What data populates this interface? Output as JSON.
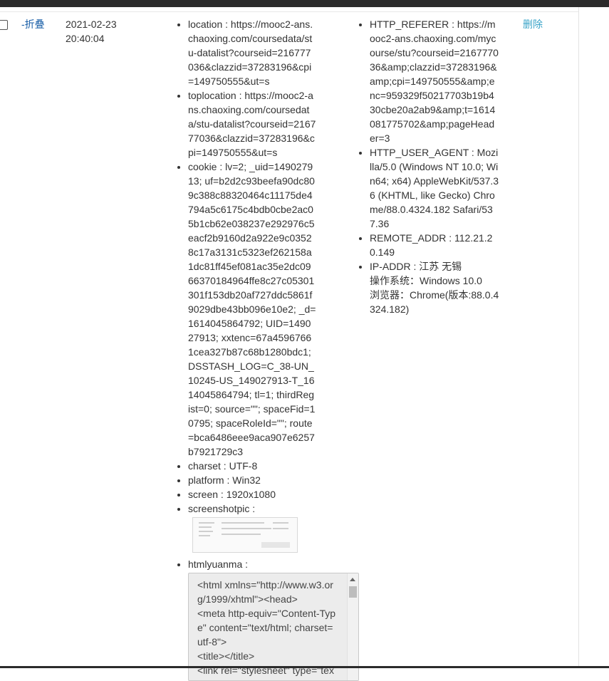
{
  "row": {
    "toggle_label": "-折叠",
    "date_line1": "2021-02-23",
    "date_line2": "20:40:04",
    "delete_label": "删除",
    "left_details": [
      "location : https://mooc2-ans.chaoxing.com/coursedata/stu-datalist?courseid=216777036&clazzid=37283196&cpi=149750555&ut=s",
      "toplocation : https://mooc2-ans.chaoxing.com/coursedata/stu-datalist?courseid=216777036&clazzid=37283196&cpi=149750555&ut=s",
      "cookie : lv=2; _uid=149027913; uf=b2d2c93beefa90dc809c388c88320464c11175de4794a5c6175c4bdb0cbe2ac05b1cb62e038237e292976c5eacf2b9160d2a922e9c03528c17a3131c5323ef262158a1dc81ff45ef081ac35e2dc0966370184964ffe8c27c05301301f153db20af727ddc5861f9029dbe43bb096e10e2; _d=1614045864792; UID=149027913; xxtenc=67a45967661cea327b87c68b1280bdc1; DSSTASH_LOG=C_38-UN_10245-US_149027913-T_1614045864794; tl=1; thirdRegist=0; source=\"\"; spaceFid=10795; spaceRoleId=\"\"; route=bca6486eee9aca907e6257b7921729c3",
      "charset : UTF-8",
      "platform : Win32",
      "screen : 1920x1080"
    ],
    "screenshot_label": "screenshotpic :",
    "html_label": "htmlyuanma :",
    "html_source": "<html xmlns=\"http://www.w3.org/1999/xhtml\"><head>\n<meta http-equiv=\"Content-Type\" content=\"text/html; charset=utf-8\">\n<title></title>\n<link rel=\"stylesheet\" type=\"text/css\" href=\"",
    "right_details": [
      "HTTP_REFERER : https://mooc2-ans.chaoxing.com/mycourse/stu?courseid=216777036&amp;clazzid=37283196&amp;cpi=149750555&amp;enc=959329f50217703b19b430cbe20a2ab9&amp;t=1614081775702&amp;pageHeader=3",
      "HTTP_USER_AGENT : Mozilla/5.0 (Windows NT 10.0; Win64; x64) AppleWebKit/537.36 (KHTML, like Gecko) Chrome/88.0.4324.182 Safari/537.36",
      "REMOTE_ADDR : 112.21.20.149"
    ],
    "ip_addr": "IP-ADDR : 江苏 无锡",
    "os": "操作系统：Windows 10.0",
    "browser": "浏览器：Chrome(版本:88.0.4324.182)"
  }
}
